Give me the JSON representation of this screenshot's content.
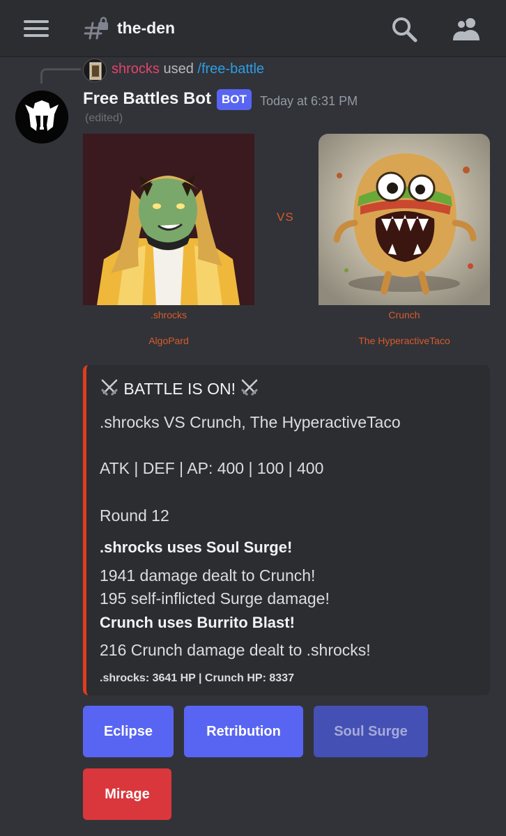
{
  "header": {
    "channel_name": "the-den",
    "channel_icon": "text-channel-locked-icon",
    "search_icon": "search-icon",
    "members_icon": "members-icon",
    "menu_icon": "hamburger-menu-icon"
  },
  "reply": {
    "user": "shrocks",
    "verb": "used",
    "command": "/free-battle"
  },
  "message": {
    "author": "Free Battles Bot",
    "badge": "BOT",
    "timestamp": "Today at 6:31 PM",
    "edited": "(edited)"
  },
  "battle_image": {
    "vs": "VS",
    "left_name": ".shrocks",
    "left_subtitle": "AlgoPard",
    "right_name": "Crunch",
    "right_subtitle": "The HyperactiveTaco"
  },
  "embed": {
    "accent_color": "#e03c1f",
    "title": "BATTLE IS ON!",
    "matchup": ".shrocks VS Crunch, The HyperactiveTaco",
    "stats": "ATK | DEF | AP: 400 | 100 | 400",
    "round": "Round 12",
    "move1": ".shrocks uses Soul Surge!",
    "result1": "1941 damage dealt to Crunch!",
    "result2": "195 self-inflicted Surge damage!",
    "move2": "Crunch uses Burrito Blast!",
    "result3": "216 Crunch damage dealt to .shrocks!",
    "footer": ".shrocks: 3641 HP | Crunch HP: 8337"
  },
  "buttons": {
    "eclipse": "Eclipse",
    "retribution": "Retribution",
    "soul_surge": "Soul Surge",
    "mirage": "Mirage"
  },
  "colors": {
    "blurple": "#5865f2",
    "danger": "#da373c",
    "background": "#313338"
  }
}
